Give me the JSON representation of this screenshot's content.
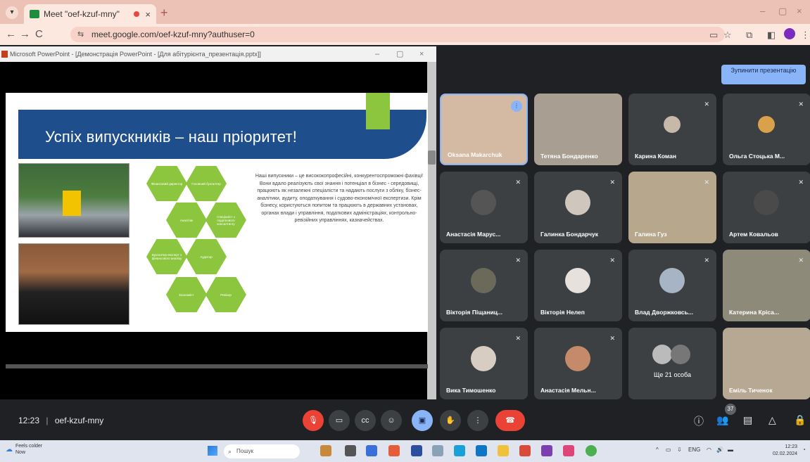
{
  "browser": {
    "tab_title": "Meet \"oef-kzuf-mny\"",
    "url": "meet.google.com/oef-kzuf-mny?authuser=0"
  },
  "powerpoint": {
    "window_title": "Microsoft PowerPoint - [Демонстрація PowerPoint - [Для абітурієнта_презентація.pptx]]",
    "slide": {
      "title": "Успіх випускників – наш пріоритет!",
      "text": "Наші випускники – це висококопрофесійні, конкурентоспроможні фахівці! Вони вдало реалізують свої знання і потенціал в бізнес - середовищі, працюють як незалежні спеціалісти та надають послуги з обліку, бізнес-аналітики, аудиту, оподаткування і судово-економічної експертизи. Крім бізнесу, користуються попитом та працюють в державних установах, органах влади і управління, податкових адміністраціях, контрольно-ревізійних управліннях, казначействах.",
      "hexagons": [
        "Фінансовий директор",
        "Головний бухгалтер",
        "Аналітик",
        "Спеціаліст з податкового консалтингу",
        "Бухгалтер-експерт з фінансового аналізу",
        "Аудитор",
        "Економіст",
        "Ревізор"
      ],
      "colors": {
        "banner": "#1f4e8c",
        "accent": "#8cc63f"
      }
    }
  },
  "meet": {
    "stop_presenting": "Зупинити презентацію",
    "meeting_time": "12:23",
    "meeting_code": "oef-kzuf-mny",
    "participant_count": "37",
    "participants": [
      {
        "name": "Oksana Makarchuk",
        "speaking": true
      },
      {
        "name": "Тетяна Бондаренко"
      },
      {
        "name": "Карина Коман"
      },
      {
        "name": "Ольга Стоцька М..."
      },
      {
        "name": "Анастасія Марус..."
      },
      {
        "name": "Галинка Бондарчук"
      },
      {
        "name": "Галина Гуз"
      },
      {
        "name": "Артем Ковальов"
      },
      {
        "name": "Вікторія Піщаниц..."
      },
      {
        "name": "Вікторія Нелеп"
      },
      {
        "name": "Влад Дворжковсь..."
      },
      {
        "name": "Катерина Кріса..."
      },
      {
        "name": "Вика Тимошенко"
      },
      {
        "name": "Анастасія Мельн..."
      },
      {
        "name": "Ще 21 особа"
      },
      {
        "name": "Еміль Тиченок"
      }
    ]
  },
  "taskbar": {
    "weather_temp": "Feels colder",
    "weather_status": "Now",
    "search_placeholder": "Пошук",
    "language": "ENG",
    "time": "12:23",
    "date": "02.02.2024"
  }
}
